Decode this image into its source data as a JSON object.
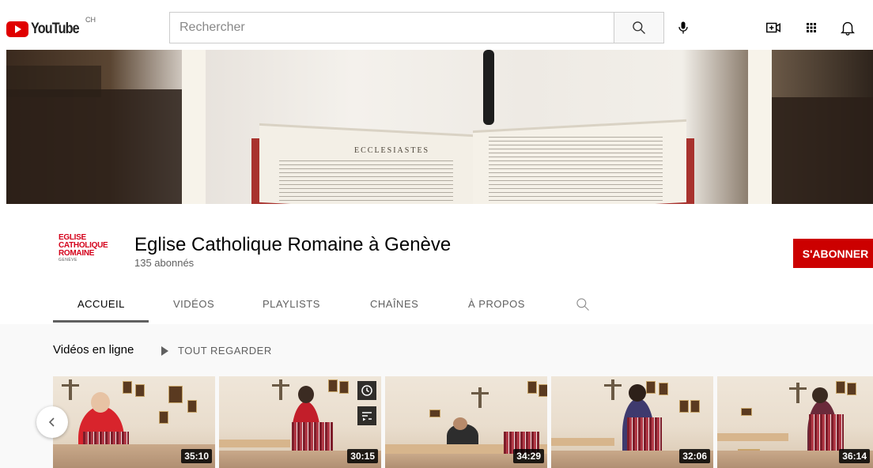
{
  "header": {
    "logo_text": "YouTube",
    "country_code": "CH",
    "search_placeholder": "Rechercher"
  },
  "banner": {
    "book_heading": "ECCLESIASTES"
  },
  "channel": {
    "logo_lines": [
      "EGLISE",
      "CATHOLIQUE",
      "ROMAINE",
      "GENÈVE"
    ],
    "name": "Eglise Catholique Romaine à Genève",
    "subscribers": "135 abonnés",
    "subscribe_label": "S'ABONNER"
  },
  "tabs": [
    {
      "label": "ACCUEIL",
      "active": true
    },
    {
      "label": "VIDÉOS",
      "active": false
    },
    {
      "label": "PLAYLISTS",
      "active": false
    },
    {
      "label": "CHAÎNES",
      "active": false
    },
    {
      "label": "À PROPOS",
      "active": false
    }
  ],
  "shelf": {
    "title": "Vidéos en ligne",
    "play_all": "TOUT REGARDER",
    "videos": [
      {
        "duration": "35:10"
      },
      {
        "duration": "30:15"
      },
      {
        "duration": "34:29"
      },
      {
        "duration": "32:06"
      },
      {
        "duration": "36:14"
      }
    ]
  },
  "colors": {
    "brand_red": "#cc0000",
    "logo_red": "#e00000",
    "text_primary": "#030303",
    "text_secondary": "#606060"
  }
}
